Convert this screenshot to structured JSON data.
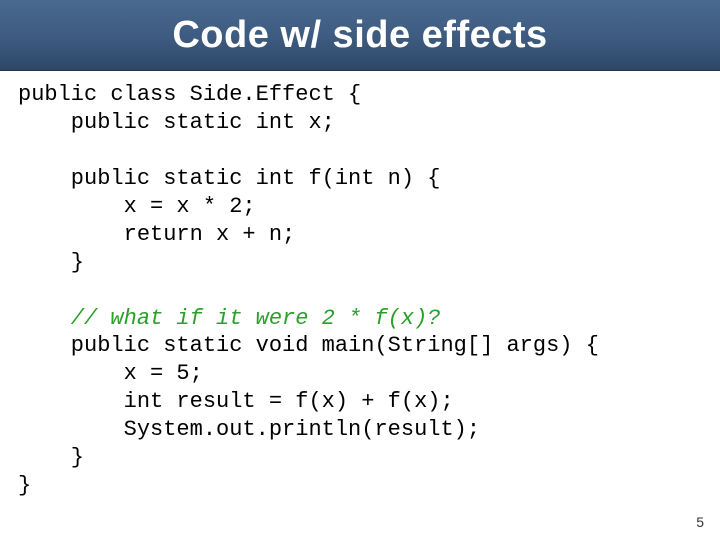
{
  "slide": {
    "title": "Code w/ side effects",
    "page_number": "5",
    "code": {
      "l1": "public class Side.Effect {",
      "l2": "    public static int x;",
      "l3": "",
      "l4": "    public static int f(int n) {",
      "l5": "        x = x * 2;",
      "l6": "        return x + n;",
      "l7": "    }",
      "l8": "",
      "c1": "    // what if it were 2 * f(x)?",
      "l9": "    public static void main(String[] args) {",
      "l10": "        x = 5;",
      "l11": "        int result = f(x) + f(x);",
      "l12": "        System.out.println(result);",
      "l13": "    }",
      "l14": "}"
    }
  }
}
